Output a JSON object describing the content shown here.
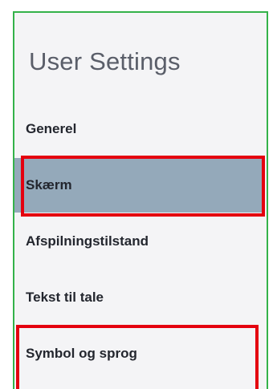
{
  "settings": {
    "title": "User Settings",
    "selected_index": 1,
    "items": [
      {
        "label": "Generel"
      },
      {
        "label": "Skærm"
      },
      {
        "label": "Afspilningstilstand"
      },
      {
        "label": "Tekst til tale"
      },
      {
        "label": "Symbol og sprog"
      }
    ]
  },
  "colors": {
    "panel_border": "#34b24a",
    "selected_background": "#94a9ba",
    "annotation_outline": "#e4000f"
  }
}
